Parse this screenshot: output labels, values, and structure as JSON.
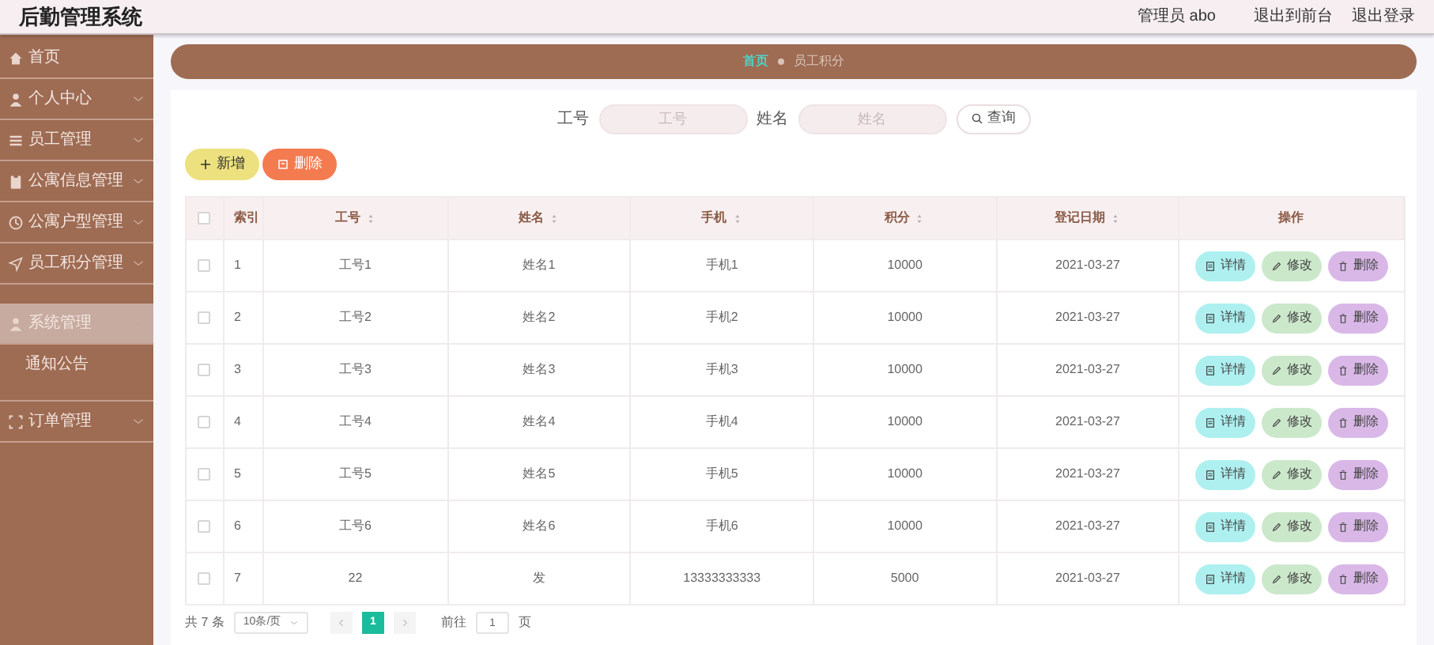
{
  "header": {
    "title": "后勤管理系统",
    "user": "管理员 abo",
    "links": [
      "退出到前台",
      "退出登录"
    ]
  },
  "sidebar": {
    "items": [
      {
        "label": "首页",
        "expandable": false,
        "selected": false
      },
      {
        "label": "个人中心",
        "expandable": true,
        "selected": false
      },
      {
        "label": "员工管理",
        "expandable": true,
        "selected": false
      },
      {
        "label": "公寓信息管理",
        "expandable": true,
        "selected": false
      },
      {
        "label": "公寓户型管理",
        "expandable": true,
        "selected": false
      },
      {
        "label": "员工积分管理",
        "expandable": true,
        "selected": false
      },
      {
        "label": "系统管理",
        "expandable": true,
        "selected": true,
        "children": [
          {
            "label": "通知公告"
          }
        ]
      },
      {
        "label": "订单管理",
        "expandable": true,
        "selected": false
      }
    ]
  },
  "breadcrumb": [
    {
      "label": "首页",
      "selected": false
    },
    {
      "label": "员工积分",
      "selected": true
    }
  ],
  "search": {
    "fields": [
      {
        "label": "工号",
        "placeholder": "工号"
      },
      {
        "label": "姓名",
        "placeholder": "姓名"
      }
    ],
    "button": "查询"
  },
  "toolbar": [
    {
      "kind": "add",
      "label": "新增"
    },
    {
      "kind": "delete",
      "label": "删除"
    }
  ],
  "table": {
    "header_checked": false,
    "columns": [
      {
        "label": "索引",
        "sortable": false
      },
      {
        "label": "工号",
        "sortable": true
      },
      {
        "label": "姓名",
        "sortable": true
      },
      {
        "label": "手机",
        "sortable": true
      },
      {
        "label": "积分",
        "sortable": true
      },
      {
        "label": "登记日期",
        "sortable": true
      },
      {
        "label": "操作",
        "sortable": false
      }
    ],
    "rows": [
      {
        "checked": false,
        "cells": [
          "1",
          "工号1",
          "姓名1",
          "手机1",
          "10000",
          "2021-03-27"
        ],
        "actions": [
          {
            "kind": "detail",
            "label": "详情"
          },
          {
            "kind": "edit",
            "label": "修改"
          },
          {
            "kind": "delete",
            "label": "删除"
          }
        ]
      },
      {
        "checked": false,
        "cells": [
          "2",
          "工号2",
          "姓名2",
          "手机2",
          "10000",
          "2021-03-27"
        ],
        "actions": [
          {
            "kind": "detail",
            "label": "详情"
          },
          {
            "kind": "edit",
            "label": "修改"
          },
          {
            "kind": "delete",
            "label": "删除"
          }
        ]
      },
      {
        "checked": false,
        "cells": [
          "3",
          "工号3",
          "姓名3",
          "手机3",
          "10000",
          "2021-03-27"
        ],
        "actions": [
          {
            "kind": "detail",
            "label": "详情"
          },
          {
            "kind": "edit",
            "label": "修改"
          },
          {
            "kind": "delete",
            "label": "删除"
          }
        ]
      },
      {
        "checked": false,
        "cells": [
          "4",
          "工号4",
          "姓名4",
          "手机4",
          "10000",
          "2021-03-27"
        ],
        "actions": [
          {
            "kind": "detail",
            "label": "详情"
          },
          {
            "kind": "edit",
            "label": "修改"
          },
          {
            "kind": "delete",
            "label": "删除"
          }
        ]
      },
      {
        "checked": false,
        "cells": [
          "5",
          "工号5",
          "姓名5",
          "手机5",
          "10000",
          "2021-03-27"
        ],
        "actions": [
          {
            "kind": "detail",
            "label": "详情"
          },
          {
            "kind": "edit",
            "label": "修改"
          },
          {
            "kind": "delete",
            "label": "删除"
          }
        ]
      },
      {
        "checked": false,
        "cells": [
          "6",
          "工号6",
          "姓名6",
          "手机6",
          "10000",
          "2021-03-27"
        ],
        "actions": [
          {
            "kind": "detail",
            "label": "详情"
          },
          {
            "kind": "edit",
            "label": "修改"
          },
          {
            "kind": "delete",
            "label": "删除"
          }
        ]
      },
      {
        "checked": false,
        "cells": [
          "7",
          "22",
          "发",
          "13333333333",
          "5000",
          "2021-03-27"
        ],
        "actions": [
          {
            "kind": "detail",
            "label": "详情"
          },
          {
            "kind": "edit",
            "label": "修改"
          },
          {
            "kind": "delete",
            "label": "删除"
          }
        ]
      }
    ]
  },
  "pagination": {
    "total": "共 7 条",
    "page_size": "10条/页",
    "pages": [
      {
        "label": "1",
        "selected": true
      }
    ],
    "goto_label": "前往",
    "goto_value": "1",
    "goto_suffix": "页"
  }
}
